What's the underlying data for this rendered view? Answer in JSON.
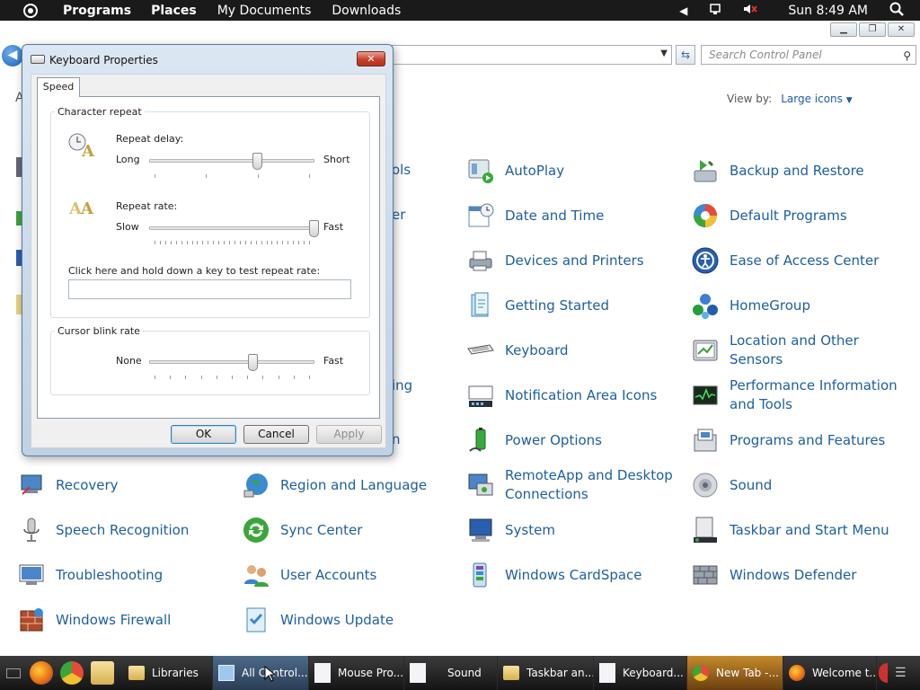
{
  "topbar": {
    "menus": [
      "Programs",
      "Places",
      "My Documents",
      "Downloads"
    ],
    "clock": "Sun 8:49 AM"
  },
  "control_panel": {
    "search_placeholder": "Search Control Panel",
    "view_by_label": "View by:",
    "view_by_value": "Large icons",
    "partial_left_fragment": "A",
    "partial_hidden_labels": [
      "ols",
      "er",
      "ing",
      "n"
    ],
    "items": [
      {
        "label": "AutoPlay",
        "icon": "autoplay-icon"
      },
      {
        "label": "Backup and Restore",
        "icon": "backup-icon"
      },
      {
        "label": "Date and Time",
        "icon": "calendar-clock-icon"
      },
      {
        "label": "Default Programs",
        "icon": "default-programs-icon"
      },
      {
        "label": "Devices and Printers",
        "icon": "printer-icon"
      },
      {
        "label": "Ease of Access Center",
        "icon": "ease-of-access-icon"
      },
      {
        "label": "Getting Started",
        "icon": "getting-started-icon"
      },
      {
        "label": "HomeGroup",
        "icon": "homegroup-icon"
      },
      {
        "label": "Keyboard",
        "icon": "keyboard-icon"
      },
      {
        "label": "Location and Other Sensors",
        "icon": "sensors-icon"
      },
      {
        "label": "Notification Area Icons",
        "icon": "notification-icon"
      },
      {
        "label": "Performance Information and Tools",
        "icon": "performance-icon"
      },
      {
        "label": "Power Options",
        "icon": "power-icon"
      },
      {
        "label": "Programs and Features",
        "icon": "programs-icon"
      },
      {
        "label": "Recovery",
        "icon": "recovery-icon"
      },
      {
        "label": "Region and Language",
        "icon": "globe-icon"
      },
      {
        "label": "RemoteApp and Desktop Connections",
        "icon": "remoteapp-icon"
      },
      {
        "label": "Sound",
        "icon": "speaker-icon"
      },
      {
        "label": "Speech Recognition",
        "icon": "microphone-icon"
      },
      {
        "label": "Sync Center",
        "icon": "sync-icon"
      },
      {
        "label": "System",
        "icon": "system-icon"
      },
      {
        "label": "Taskbar and Start Menu",
        "icon": "taskbar-icon"
      },
      {
        "label": "Troubleshooting",
        "icon": "troubleshoot-icon"
      },
      {
        "label": "User Accounts",
        "icon": "users-icon"
      },
      {
        "label": "Windows CardSpace",
        "icon": "cardspace-icon"
      },
      {
        "label": "Windows Defender",
        "icon": "defender-icon"
      },
      {
        "label": "Windows Firewall",
        "icon": "firewall-icon"
      },
      {
        "label": "Windows Update",
        "icon": "update-icon"
      }
    ]
  },
  "dialog": {
    "title": "Keyboard Properties",
    "tab": "Speed",
    "character_repeat_label": "Character repeat",
    "repeat_delay_label": "Repeat delay:",
    "repeat_delay_min": "Long",
    "repeat_delay_max": "Short",
    "repeat_delay_level": 0.66,
    "repeat_rate_label": "Repeat rate:",
    "repeat_rate_min": "Slow",
    "repeat_rate_max": "Fast",
    "repeat_rate_level": 1.0,
    "test_label": "Click here and hold down a key to test repeat rate:",
    "test_value": "",
    "cursor_blink_label": "Cursor blink rate",
    "cursor_blink_min": "None",
    "cursor_blink_max": "Fast",
    "cursor_blink_level": 0.63,
    "ok": "OK",
    "cancel": "Cancel",
    "apply": "Apply"
  },
  "taskbar": {
    "buttons": [
      "Libraries",
      "All Control...",
      "Mouse Pro...",
      "Sound",
      "Taskbar an...",
      "Keyboard...",
      "New Tab -...",
      "Welcome t..."
    ]
  },
  "colors": {
    "link": "#1e5fa0",
    "topbar": "#1a1a1a",
    "dialog_frame": "#c9d9ea",
    "close_button": "#c8412a"
  }
}
